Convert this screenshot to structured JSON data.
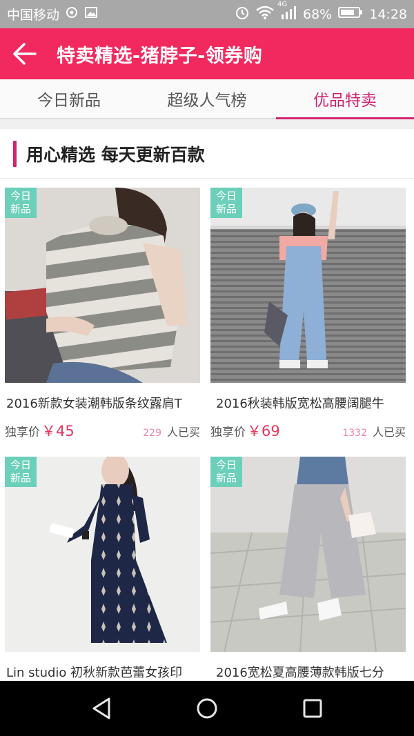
{
  "status_bar": {
    "carrier": "中国移动",
    "network": "4G",
    "battery": "68%",
    "time": "14:28"
  },
  "header": {
    "title": "特卖精选-猪脖子-领券购",
    "back_icon": "arrow-left-icon"
  },
  "tabs": [
    {
      "label": "今日新品",
      "active": false
    },
    {
      "label": "超级人气榜",
      "active": false
    },
    {
      "label": "优品特卖",
      "active": true
    }
  ],
  "section": {
    "title": "用心精选  每天更新百款"
  },
  "products": [
    {
      "badge_line1": "今日",
      "badge_line2": "新品",
      "name": "2016新款女装潮韩版条纹露肩T",
      "price_label": "独享价",
      "price": "￥45",
      "count": "229",
      "buy_label": "人已买"
    },
    {
      "badge_line1": "今日",
      "badge_line2": "新品",
      "name": "2016秋装韩版宽松高腰阔腿牛",
      "price_label": "独享价",
      "price": "￥69",
      "count": "1332",
      "buy_label": "人已买"
    },
    {
      "badge_line1": "今日",
      "badge_line2": "新品",
      "name": "Lin studio 初秋新款芭蕾女孩印"
    },
    {
      "badge_line1": "今日",
      "badge_line2": "新品",
      "name": "2016宽松夏高腰薄款韩版七分"
    }
  ],
  "colors": {
    "brand": "#f2295e",
    "accent": "#d02370",
    "badge": "#6ccfb9",
    "price": "#e8365e"
  }
}
